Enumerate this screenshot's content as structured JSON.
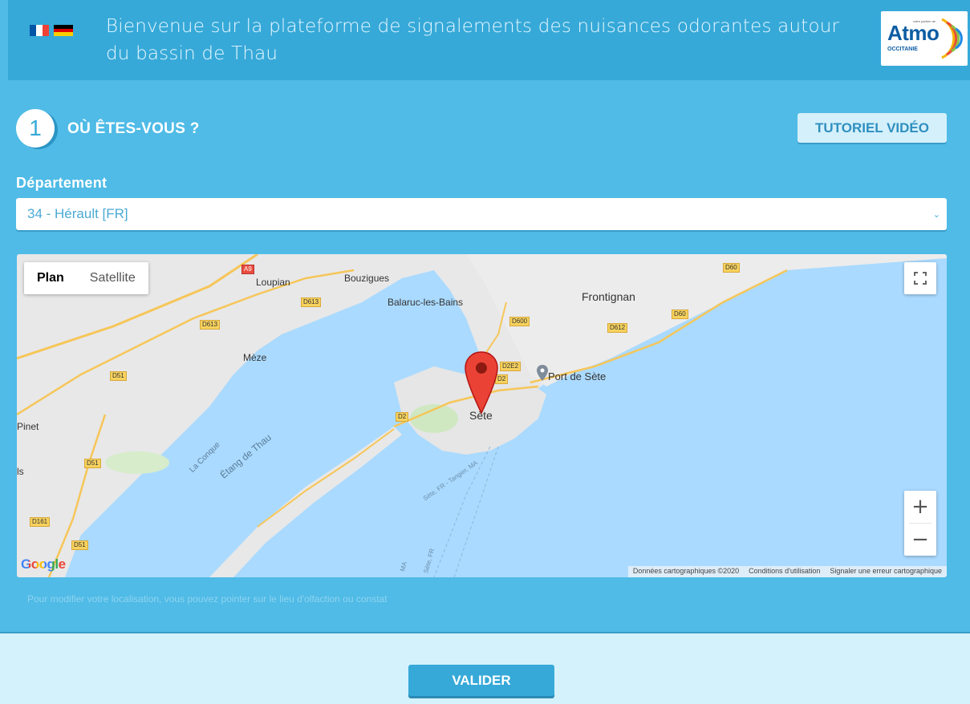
{
  "header": {
    "title": "Bienvenue sur la plateforme de signalements des nuisances odorantes autour du bassin de Thau",
    "languages": [
      {
        "name": "fr-flag-icon",
        "colors": [
          "#0055a4",
          "#ffffff",
          "#ef4135"
        ]
      },
      {
        "name": "de-flag-icon",
        "colors": [
          "#000000",
          "#dd0000",
          "#ffce00"
        ]
      }
    ],
    "logo": {
      "brand": "Atmo",
      "region": "OCCITANIE",
      "tagline": "votre parfum air"
    }
  },
  "step": {
    "number": "1",
    "title": "OÙ ÊTES-VOUS ?",
    "tutorial_label": "TUTORIEL VIDÉO"
  },
  "department": {
    "label": "Département",
    "selected": "34 - Hérault [FR]"
  },
  "map": {
    "type_controls": {
      "plan": "Plan",
      "satellite": "Satellite"
    },
    "places": {
      "loupian": "Loupian",
      "bouzigues": "Bouzigues",
      "balaruc": "Balaruc-les-Bains",
      "frontignan": "Frontignan",
      "meze": "Mèze",
      "port": "Port de Sète",
      "sete": "Sète",
      "pinet": "Pinet",
      "la_conque": "La Conque",
      "etang": "Étang de Thau",
      "route": "Sète, FR - Tangier, MA",
      "route_ma": "MA",
      "route_sete": "Sète, FR",
      "edge_s": "ls"
    },
    "road_tags": {
      "a9": "A9",
      "d613a": "D613",
      "d613b": "D613",
      "d600": "D600",
      "d612": "D612",
      "d60a": "D60",
      "d60b": "D60",
      "d51a": "D51",
      "d51b": "D51",
      "d51c": "D51",
      "d2e2": "D2E2",
      "d2a": "D2",
      "d2b": "D2",
      "d161": "D161"
    },
    "zoom_in": "+",
    "zoom_out": "−",
    "google": "Google",
    "footer": {
      "data": "Données cartographiques ©2020",
      "terms": "Conditions d'utilisation",
      "report": "Signaler une erreur cartographique"
    },
    "colors": {
      "water": "#aadaff",
      "land": "#e8e8e8",
      "marker": "#ea4335"
    }
  },
  "hint": "Pour modifier votre localisation, vous pouvez pointer sur le lieu d'olfaction ou constat",
  "validate_label": "VALIDER"
}
